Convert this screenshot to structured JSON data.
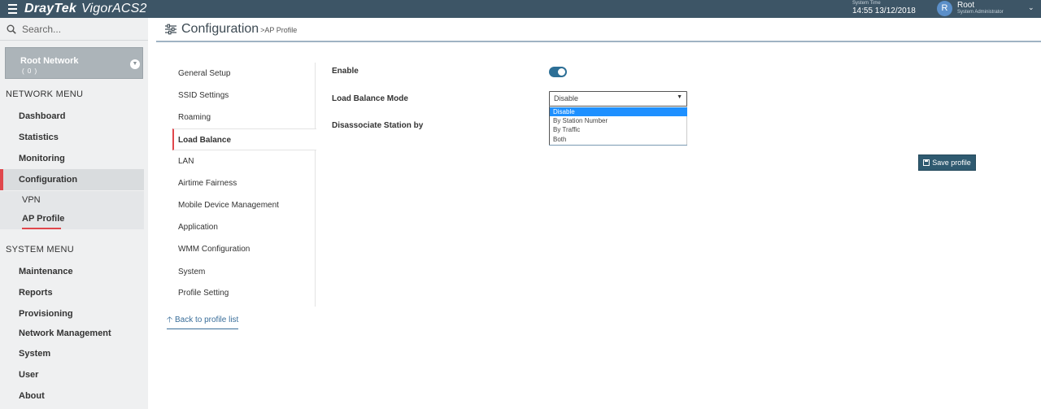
{
  "app": {
    "brand": "DrayTek",
    "product": "VigorACS2"
  },
  "system_time": {
    "label": "System Time",
    "value": "14:55 13/12/2018"
  },
  "user": {
    "initial": "R",
    "name": "Root",
    "role": "System Administrator"
  },
  "search": {
    "placeholder": "Search..."
  },
  "root_network": {
    "title": "Root Network",
    "count": "( 0 )"
  },
  "network_menu": {
    "heading": "NETWORK MENU",
    "items": [
      {
        "label": "Dashboard"
      },
      {
        "label": "Statistics"
      },
      {
        "label": "Monitoring"
      },
      {
        "label": "Configuration",
        "active": true
      }
    ],
    "subitems": [
      {
        "label": "VPN"
      },
      {
        "label": "AP Profile",
        "active": true
      }
    ]
  },
  "system_menu": {
    "heading": "SYSTEM MENU",
    "items": [
      {
        "label": "Maintenance"
      },
      {
        "label": "Reports"
      },
      {
        "label": "Provisioning"
      },
      {
        "label": "Network Management"
      },
      {
        "label": "System"
      },
      {
        "label": "User"
      },
      {
        "label": "About"
      }
    ]
  },
  "page": {
    "title": "Configuration",
    "breadcrumb": ">AP Profile"
  },
  "profile_nav": {
    "items": [
      {
        "label": "General Setup"
      },
      {
        "label": "SSID Settings"
      },
      {
        "label": "Roaming"
      },
      {
        "label": "Load Balance",
        "active": true
      },
      {
        "label": "LAN"
      },
      {
        "label": "Airtime Fairness"
      },
      {
        "label": "Mobile Device Management"
      },
      {
        "label": "Application"
      },
      {
        "label": "WMM Configuration"
      },
      {
        "label": "System"
      },
      {
        "label": "Profile Setting"
      }
    ],
    "back_link": "Back to profile list"
  },
  "load_balance": {
    "enable_label": "Enable",
    "enabled": true,
    "mode_label": "Load Balance Mode",
    "mode_value": "Disable",
    "mode_options": [
      "Disable",
      "By Station Number",
      "By Traffic",
      "Both"
    ],
    "disassociate_label": "Disassociate Station by",
    "save_label": "Save profile"
  },
  "colors": {
    "topbar": "#3d5566",
    "accent_red": "#e0474c",
    "toggle_on": "#2d6f96",
    "save_button": "#2f5a70",
    "dropdown_highlight": "#1e90ff"
  }
}
